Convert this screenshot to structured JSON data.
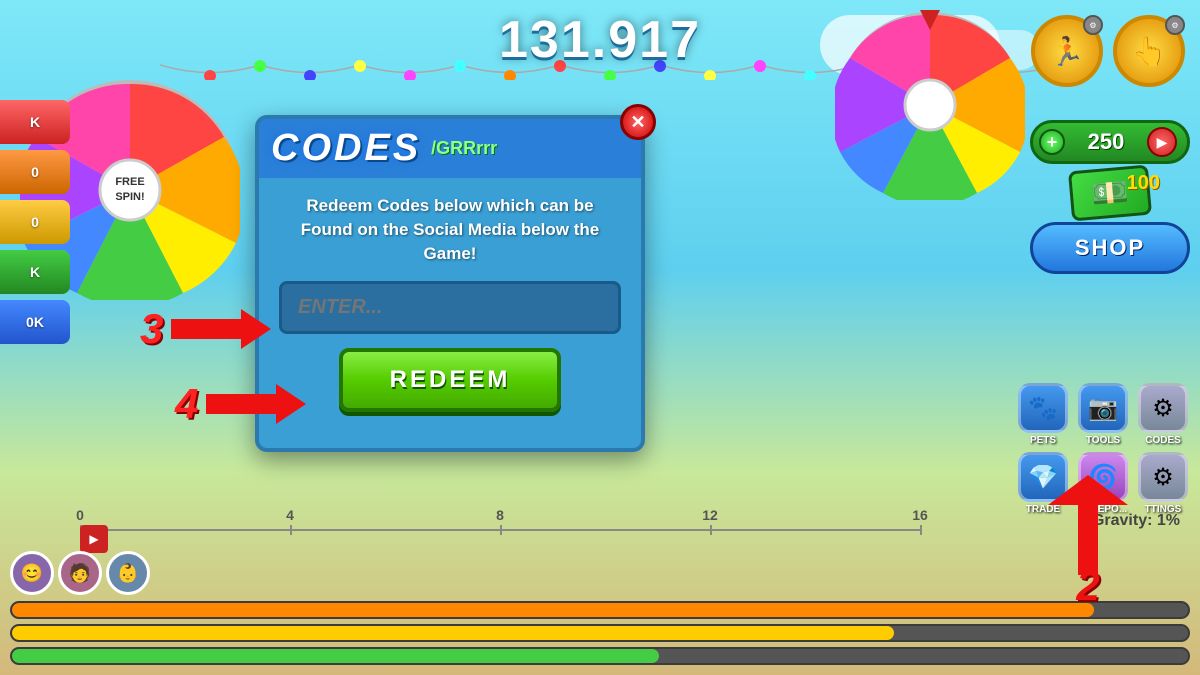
{
  "game": {
    "score": "131.917",
    "gravity_label": "Gravity: 1%",
    "currency": "250"
  },
  "codes_dialog": {
    "title": "CODES",
    "subtitle": "/GRRrrr",
    "description_line1": "Redeem Codes below which can be",
    "description_line2": "Found on the Social Media below the Game!",
    "input_placeholder": "ENTER...",
    "redeem_button": "REDEEM",
    "close_icon": "✕"
  },
  "arrows": {
    "arrow3_label": "3",
    "arrow4_label": "4",
    "arrow2_label": "2"
  },
  "right_panel": {
    "currency_amount": "250",
    "plus_icon": "+",
    "play_icon": "▶",
    "shop_label": "SHOP"
  },
  "nav_icons": [
    {
      "label": "PETS",
      "icon": "🐾",
      "bg": "#5588cc"
    },
    {
      "label": "TOOLS",
      "icon": "📷",
      "bg": "#5588cc"
    },
    {
      "label": "CODES",
      "icon": "⚙",
      "bg": "#5588cc"
    },
    {
      "label": "TRADE",
      "icon": "💎",
      "bg": "#5588cc"
    },
    {
      "label": "TELEPO...",
      "icon": "🌀",
      "bg": "#5588cc"
    },
    {
      "label": "TTINGS",
      "icon": "⚙",
      "bg": "#5588cc"
    }
  ],
  "progress_bars": [
    {
      "color": "#ff8800",
      "fill": 92
    },
    {
      "color": "#ffcc00",
      "fill": 75
    },
    {
      "color": "#44cc44",
      "fill": 55
    }
  ],
  "ruler": {
    "marks": [
      "0",
      "4",
      "8",
      "12",
      "16"
    ]
  },
  "top_circle_btns": [
    {
      "icon": "🏃",
      "badge": "⚙"
    },
    {
      "icon": "👆",
      "badge": "⚙"
    }
  ]
}
